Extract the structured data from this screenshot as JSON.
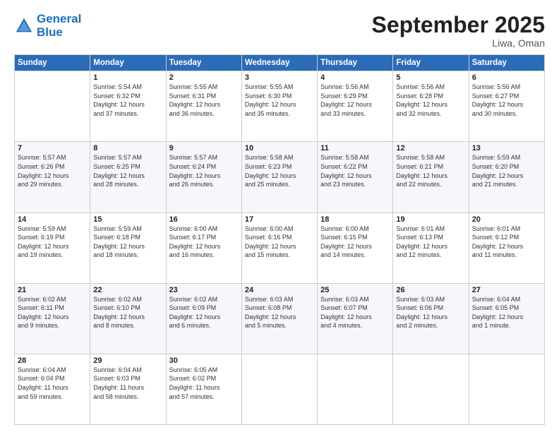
{
  "header": {
    "logo_line1": "General",
    "logo_line2": "Blue",
    "month": "September 2025",
    "location": "Liwa, Oman"
  },
  "weekdays": [
    "Sunday",
    "Monday",
    "Tuesday",
    "Wednesday",
    "Thursday",
    "Friday",
    "Saturday"
  ],
  "weeks": [
    [
      {
        "day": "",
        "info": ""
      },
      {
        "day": "1",
        "info": "Sunrise: 5:54 AM\nSunset: 6:32 PM\nDaylight: 12 hours\nand 37 minutes."
      },
      {
        "day": "2",
        "info": "Sunrise: 5:55 AM\nSunset: 6:31 PM\nDaylight: 12 hours\nand 36 minutes."
      },
      {
        "day": "3",
        "info": "Sunrise: 5:55 AM\nSunset: 6:30 PM\nDaylight: 12 hours\nand 35 minutes."
      },
      {
        "day": "4",
        "info": "Sunrise: 5:56 AM\nSunset: 6:29 PM\nDaylight: 12 hours\nand 33 minutes."
      },
      {
        "day": "5",
        "info": "Sunrise: 5:56 AM\nSunset: 6:28 PM\nDaylight: 12 hours\nand 32 minutes."
      },
      {
        "day": "6",
        "info": "Sunrise: 5:56 AM\nSunset: 6:27 PM\nDaylight: 12 hours\nand 30 minutes."
      }
    ],
    [
      {
        "day": "7",
        "info": "Sunrise: 5:57 AM\nSunset: 6:26 PM\nDaylight: 12 hours\nand 29 minutes."
      },
      {
        "day": "8",
        "info": "Sunrise: 5:57 AM\nSunset: 6:25 PM\nDaylight: 12 hours\nand 28 minutes."
      },
      {
        "day": "9",
        "info": "Sunrise: 5:57 AM\nSunset: 6:24 PM\nDaylight: 12 hours\nand 26 minutes."
      },
      {
        "day": "10",
        "info": "Sunrise: 5:58 AM\nSunset: 6:23 PM\nDaylight: 12 hours\nand 25 minutes."
      },
      {
        "day": "11",
        "info": "Sunrise: 5:58 AM\nSunset: 6:22 PM\nDaylight: 12 hours\nand 23 minutes."
      },
      {
        "day": "12",
        "info": "Sunrise: 5:58 AM\nSunset: 6:21 PM\nDaylight: 12 hours\nand 22 minutes."
      },
      {
        "day": "13",
        "info": "Sunrise: 5:59 AM\nSunset: 6:20 PM\nDaylight: 12 hours\nand 21 minutes."
      }
    ],
    [
      {
        "day": "14",
        "info": "Sunrise: 5:59 AM\nSunset: 6:19 PM\nDaylight: 12 hours\nand 19 minutes."
      },
      {
        "day": "15",
        "info": "Sunrise: 5:59 AM\nSunset: 6:18 PM\nDaylight: 12 hours\nand 18 minutes."
      },
      {
        "day": "16",
        "info": "Sunrise: 6:00 AM\nSunset: 6:17 PM\nDaylight: 12 hours\nand 16 minutes."
      },
      {
        "day": "17",
        "info": "Sunrise: 6:00 AM\nSunset: 6:16 PM\nDaylight: 12 hours\nand 15 minutes."
      },
      {
        "day": "18",
        "info": "Sunrise: 6:00 AM\nSunset: 6:15 PM\nDaylight: 12 hours\nand 14 minutes."
      },
      {
        "day": "19",
        "info": "Sunrise: 6:01 AM\nSunset: 6:13 PM\nDaylight: 12 hours\nand 12 minutes."
      },
      {
        "day": "20",
        "info": "Sunrise: 6:01 AM\nSunset: 6:12 PM\nDaylight: 12 hours\nand 11 minutes."
      }
    ],
    [
      {
        "day": "21",
        "info": "Sunrise: 6:02 AM\nSunset: 6:11 PM\nDaylight: 12 hours\nand 9 minutes."
      },
      {
        "day": "22",
        "info": "Sunrise: 6:02 AM\nSunset: 6:10 PM\nDaylight: 12 hours\nand 8 minutes."
      },
      {
        "day": "23",
        "info": "Sunrise: 6:02 AM\nSunset: 6:09 PM\nDaylight: 12 hours\nand 6 minutes."
      },
      {
        "day": "24",
        "info": "Sunrise: 6:03 AM\nSunset: 6:08 PM\nDaylight: 12 hours\nand 5 minutes."
      },
      {
        "day": "25",
        "info": "Sunrise: 6:03 AM\nSunset: 6:07 PM\nDaylight: 12 hours\nand 4 minutes."
      },
      {
        "day": "26",
        "info": "Sunrise: 6:03 AM\nSunset: 6:06 PM\nDaylight: 12 hours\nand 2 minutes."
      },
      {
        "day": "27",
        "info": "Sunrise: 6:04 AM\nSunset: 6:05 PM\nDaylight: 12 hours\nand 1 minute."
      }
    ],
    [
      {
        "day": "28",
        "info": "Sunrise: 6:04 AM\nSunset: 6:04 PM\nDaylight: 11 hours\nand 59 minutes."
      },
      {
        "day": "29",
        "info": "Sunrise: 6:04 AM\nSunset: 6:03 PM\nDaylight: 11 hours\nand 58 minutes."
      },
      {
        "day": "30",
        "info": "Sunrise: 6:05 AM\nSunset: 6:02 PM\nDaylight: 11 hours\nand 57 minutes."
      },
      {
        "day": "",
        "info": ""
      },
      {
        "day": "",
        "info": ""
      },
      {
        "day": "",
        "info": ""
      },
      {
        "day": "",
        "info": ""
      }
    ]
  ]
}
